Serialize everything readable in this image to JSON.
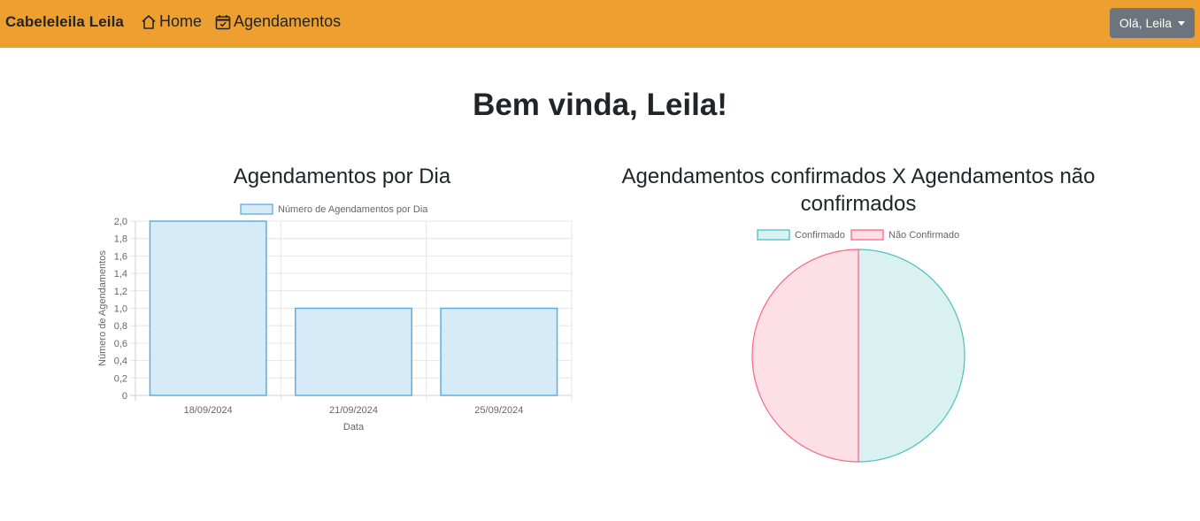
{
  "navbar": {
    "brand": "Cabeleleila Leila",
    "links": [
      {
        "label": "Home",
        "icon": "house-icon"
      },
      {
        "label": "Agendamentos",
        "icon": "calendar-check-icon"
      }
    ],
    "user_menu": "Olá, Leila",
    "background": "#eda02f"
  },
  "page_title": "Bem vinda, Leila!",
  "chart_data": [
    {
      "type": "bar",
      "title": "Agendamentos por Dia",
      "legend": "Número de Agendamentos por Dia",
      "categories": [
        "18/09/2024",
        "21/09/2024",
        "25/09/2024"
      ],
      "values": [
        2,
        1,
        1
      ],
      "xlabel": "Data",
      "ylabel": "Número de Agendamentos",
      "ylim": [
        0,
        2
      ],
      "yticks": [
        "0",
        "0,2",
        "0,4",
        "0,6",
        "0,8",
        "1,0",
        "1,2",
        "1,4",
        "1,6",
        "1,8",
        "2,0"
      ],
      "grid": true,
      "legend_position": "top",
      "fill": "#d6eaf8",
      "stroke": "#5dade2"
    },
    {
      "type": "pie",
      "title": "Agendamentos confirmados X Agendamentos não confirmados",
      "labels": [
        "Confirmado",
        "Não Confirmado"
      ],
      "values": [
        1,
        1
      ],
      "legend_position": "top",
      "fills": [
        "#d9f1f1",
        "#fde0e6"
      ],
      "strokes": [
        "#4bc0c0",
        "#ff6384"
      ]
    }
  ]
}
